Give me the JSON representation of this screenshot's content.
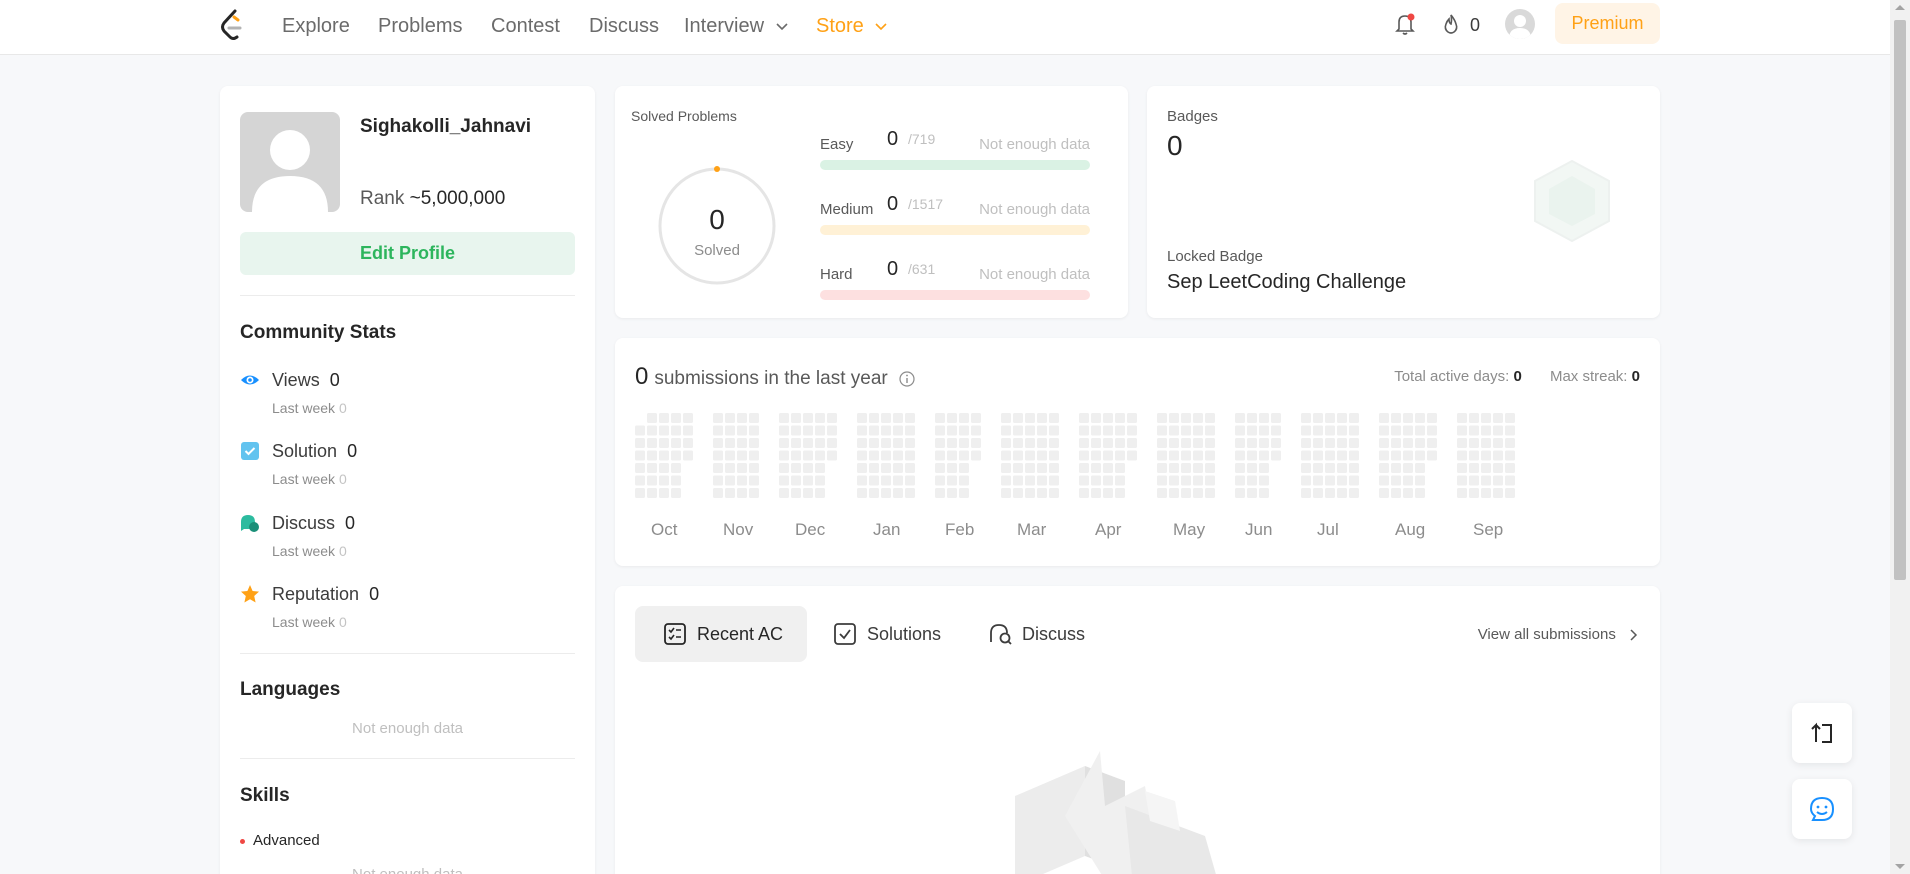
{
  "nav": {
    "links": [
      "Explore",
      "Problems",
      "Contest",
      "Discuss",
      "Interview",
      "Store"
    ],
    "fire_count": "0",
    "premium": "Premium",
    "colors": {
      "accent": "#ffa116"
    }
  },
  "profile": {
    "username": "Sighakolli_Jahnavi",
    "rank_label": "Rank",
    "rank_value": "~5,000,000",
    "edit_profile": "Edit Profile"
  },
  "community": {
    "title": "Community Stats",
    "stats": [
      {
        "label": "Views",
        "value": "0",
        "sub_label": "Last week",
        "sub_value": "0",
        "icon": "eye-icon"
      },
      {
        "label": "Solution",
        "value": "0",
        "sub_label": "Last week",
        "sub_value": "0",
        "icon": "solution-check-icon"
      },
      {
        "label": "Discuss",
        "value": "0",
        "sub_label": "Last week",
        "sub_value": "0",
        "icon": "discuss-bubble-icon"
      },
      {
        "label": "Reputation",
        "value": "0",
        "sub_label": "Last week",
        "sub_value": "0",
        "icon": "star-icon"
      }
    ]
  },
  "languages": {
    "title": "Languages",
    "empty": "Not enough data"
  },
  "skills": {
    "title": "Skills",
    "level": "Advanced",
    "empty": "Not enough data"
  },
  "solved": {
    "title": "Solved Problems",
    "total": "0",
    "total_label": "Solved",
    "difficulties": [
      {
        "name": "Easy",
        "count": "0",
        "total": "/719",
        "note": "Not enough data",
        "color": "#daf2e4"
      },
      {
        "name": "Medium",
        "count": "0",
        "total": "/1517",
        "note": "Not enough data",
        "color": "#fff1d6"
      },
      {
        "name": "Hard",
        "count": "0",
        "total": "/631",
        "note": "Not enough data",
        "color": "#fde0e0"
      }
    ]
  },
  "badges": {
    "label": "Badges",
    "count": "0",
    "locked_label": "Locked Badge",
    "locked_name": "Sep LeetCoding Challenge"
  },
  "submissions": {
    "count": "0",
    "title": "submissions in the last year",
    "active_days_label": "Total active days:",
    "active_days": "0",
    "max_streak_label": "Max streak:",
    "max_streak": "0",
    "months": [
      "Oct",
      "Nov",
      "Dec",
      "Jan",
      "Feb",
      "Mar",
      "Apr",
      "May",
      "Jun",
      "Jul",
      "Aug",
      "Sep"
    ]
  },
  "recent": {
    "tabs": [
      "Recent AC",
      "Solutions",
      "Discuss"
    ],
    "view_all": "View all submissions"
  }
}
